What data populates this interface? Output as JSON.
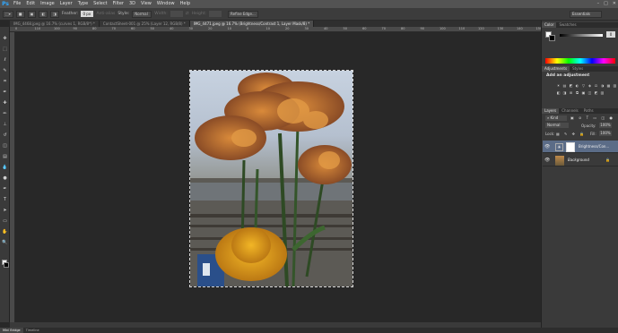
{
  "app": {
    "logo": "Ps"
  },
  "menu": [
    "File",
    "Edit",
    "Image",
    "Layer",
    "Type",
    "Select",
    "Filter",
    "3D",
    "View",
    "Window",
    "Help"
  ],
  "window_controls": [
    "–",
    "□",
    "✕"
  ],
  "options": {
    "feather_label": "Feather:",
    "feather_value": "0 px",
    "antialias_label": "Anti-alias",
    "style_label": "Style:",
    "style_value": "Normal",
    "width_label": "Width:",
    "height_label": "Height:",
    "refine_button": "Refine Edge...",
    "workspace": "Essentials"
  },
  "tabs": [
    {
      "label": "IMG_4468.jpeg @ 16.7% (curves 1, RGB/8*) *",
      "active": false
    },
    {
      "label": "ContactSheet-001 @ 25% (Layer 12, RGB/8) *",
      "active": false
    },
    {
      "label": "IMG_4471.jpeg @ 16.7% (Brightness/Contrast 1, Layer Mask/8) *",
      "active": true
    }
  ],
  "ruler_ticks": [
    "0",
    "110",
    "100",
    "90",
    "80",
    "70",
    "60",
    "50",
    "40",
    "30",
    "20",
    "10",
    "0",
    "10",
    "20",
    "30",
    "40",
    "50",
    "60",
    "70",
    "80",
    "90",
    "100",
    "110",
    "120",
    "130",
    "140",
    "150"
  ],
  "tools": [
    "move-icon",
    "marquee-icon",
    "lasso-icon",
    "quick-select-icon",
    "crop-icon",
    "eyedropper-icon",
    "healing-icon",
    "brush-icon",
    "stamp-icon",
    "history-brush-icon",
    "eraser-icon",
    "gradient-icon",
    "blur-icon",
    "dodge-icon",
    "pen-icon",
    "type-icon",
    "path-select-icon",
    "shape-icon",
    "hand-icon",
    "zoom-icon"
  ],
  "tool_glyphs": [
    "✥",
    "⬚",
    "ℓ",
    "✎",
    "⌗",
    "✒",
    "✚",
    "✏",
    "⊥",
    "↺",
    "◫",
    "▤",
    "💧",
    "●",
    "✒",
    "T",
    "➤",
    "▭",
    "✋",
    "🔍"
  ],
  "status": {
    "left": "",
    "bottom_tabs": [
      "Mini Bridge",
      "Timeline"
    ]
  },
  "panels": {
    "color_tabs": [
      "Color",
      "Swatches"
    ],
    "color_value": "0",
    "adj_tabs": [
      "Adjustments",
      "Styles"
    ],
    "adj_title": "Add an adjustment",
    "layer_tabs": [
      "Layers",
      "Channels",
      "Paths"
    ],
    "kind_label": "Kind",
    "blend_mode": "Normal",
    "opacity_label": "Opacity:",
    "opacity_value": "100%",
    "lock_label": "Lock:",
    "fill_label": "Fill:",
    "fill_value": "100%",
    "layers": [
      {
        "name": "Brightness/Con...",
        "selected": true
      },
      {
        "name": "Background",
        "selected": false
      }
    ]
  }
}
